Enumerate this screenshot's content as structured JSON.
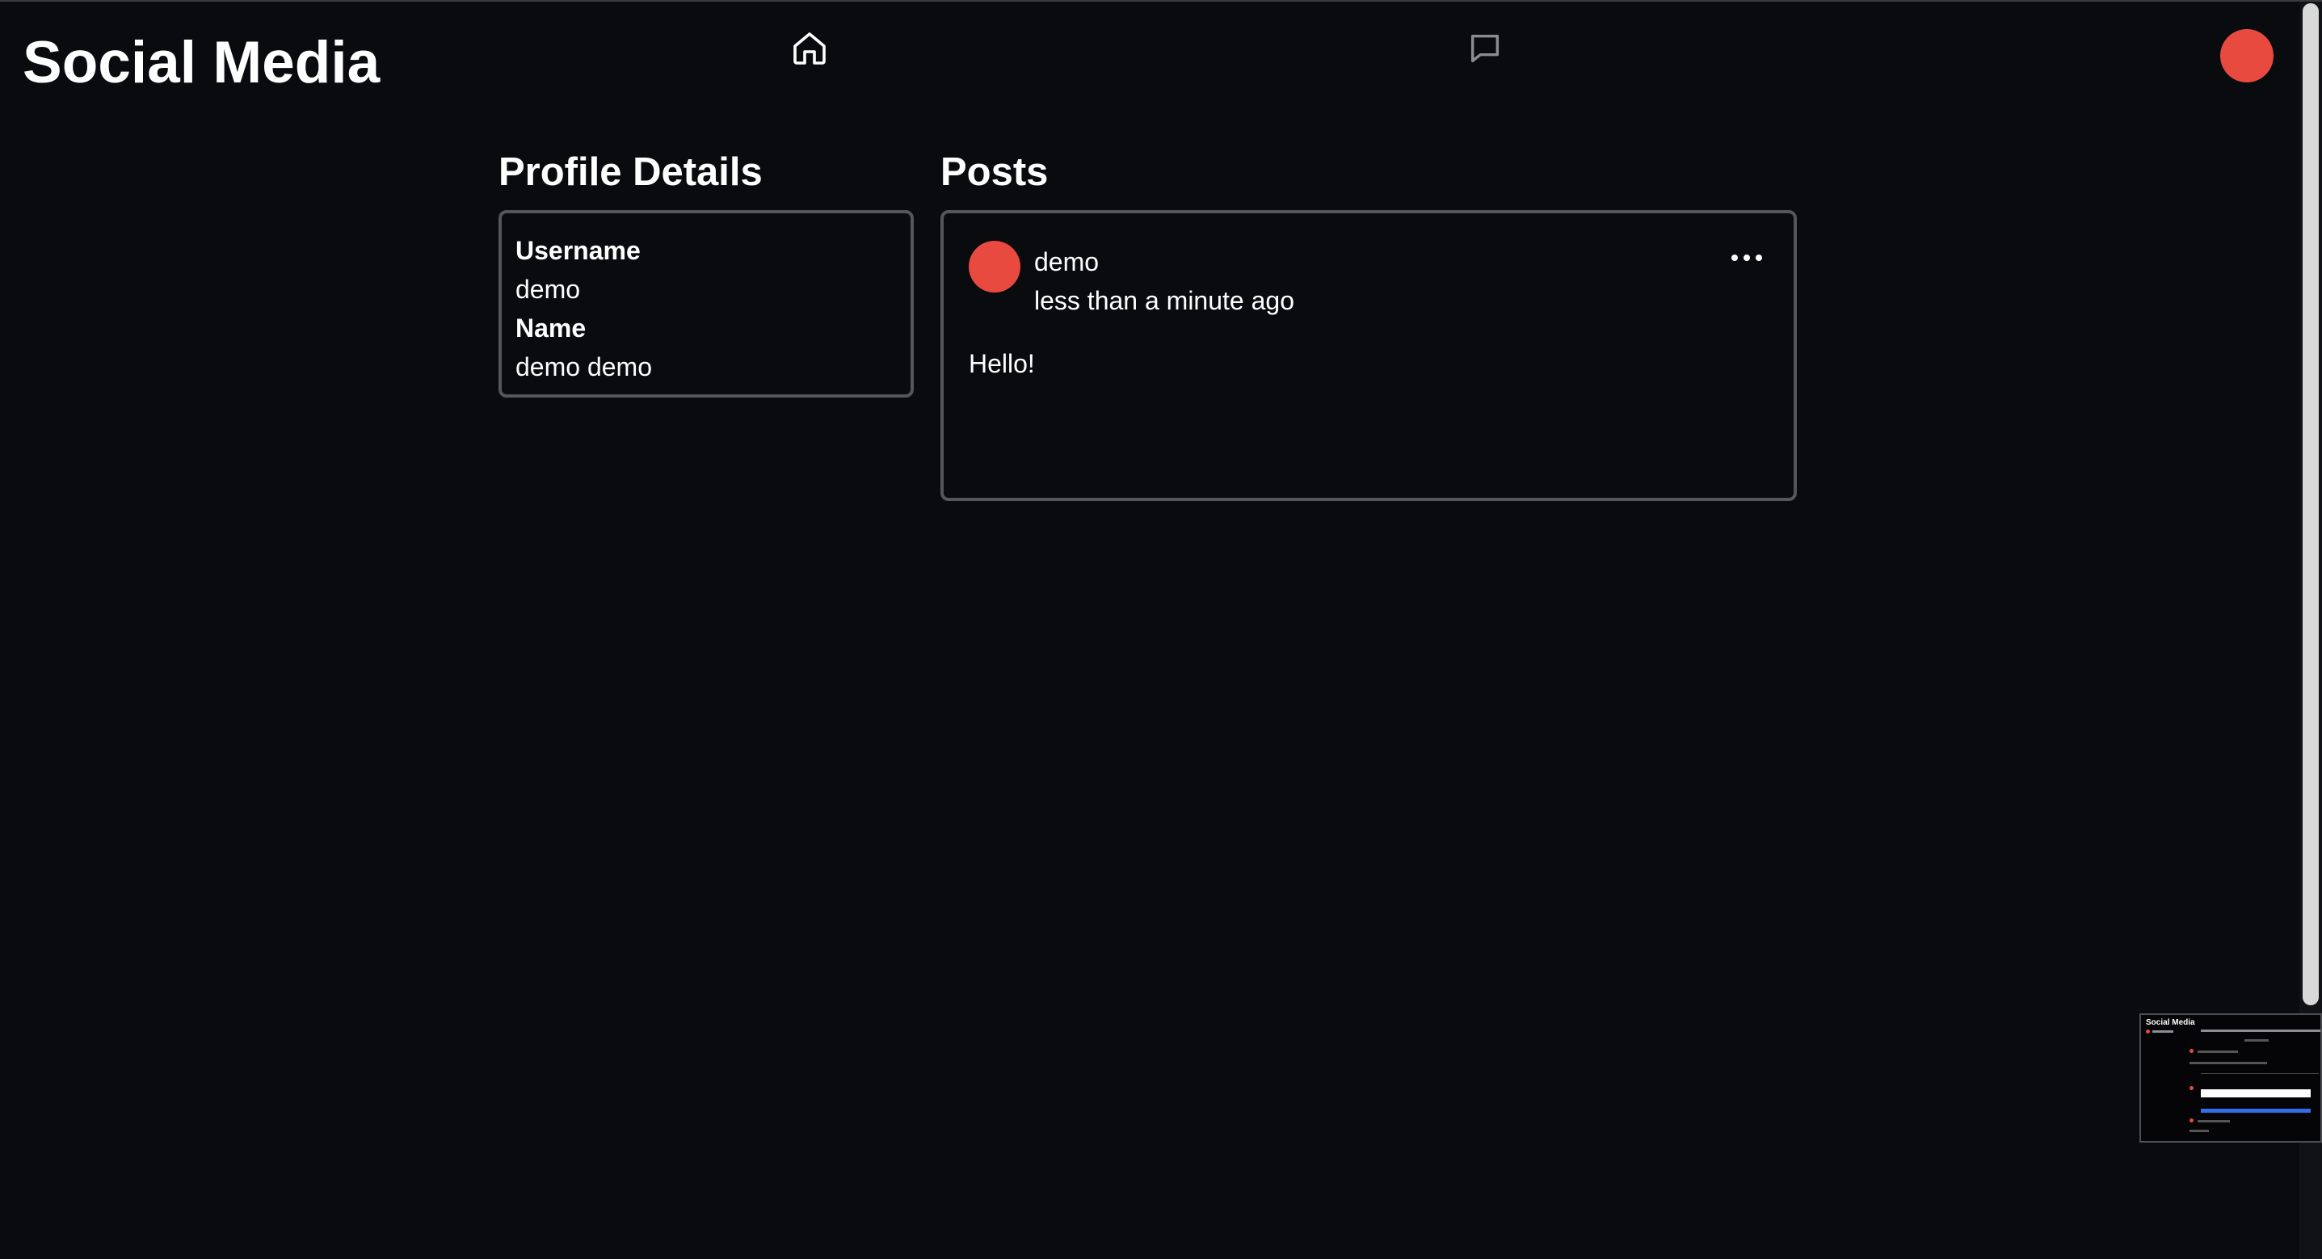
{
  "header": {
    "app_title": "Social Media",
    "nav": [
      {
        "icon": "home-icon"
      },
      {
        "icon": "chat-icon"
      }
    ],
    "avatar_color": "#e84a3f"
  },
  "profile": {
    "section_title": "Profile Details",
    "username_label": "Username",
    "username_value": "demo",
    "name_label": "Name",
    "name_value": "demo demo"
  },
  "posts": {
    "section_title": "Posts",
    "items": [
      {
        "author": "demo",
        "time": "less than a minute ago",
        "body": "Hello!",
        "avatar_color": "#e84a3f",
        "menu_icon": "more-horizontal-icon"
      }
    ]
  },
  "preview": {
    "title": "Social Media"
  },
  "colors": {
    "background": "#0a0b0f",
    "accent": "#e84a3f",
    "border": "#55565c",
    "text": "#ffffff"
  }
}
